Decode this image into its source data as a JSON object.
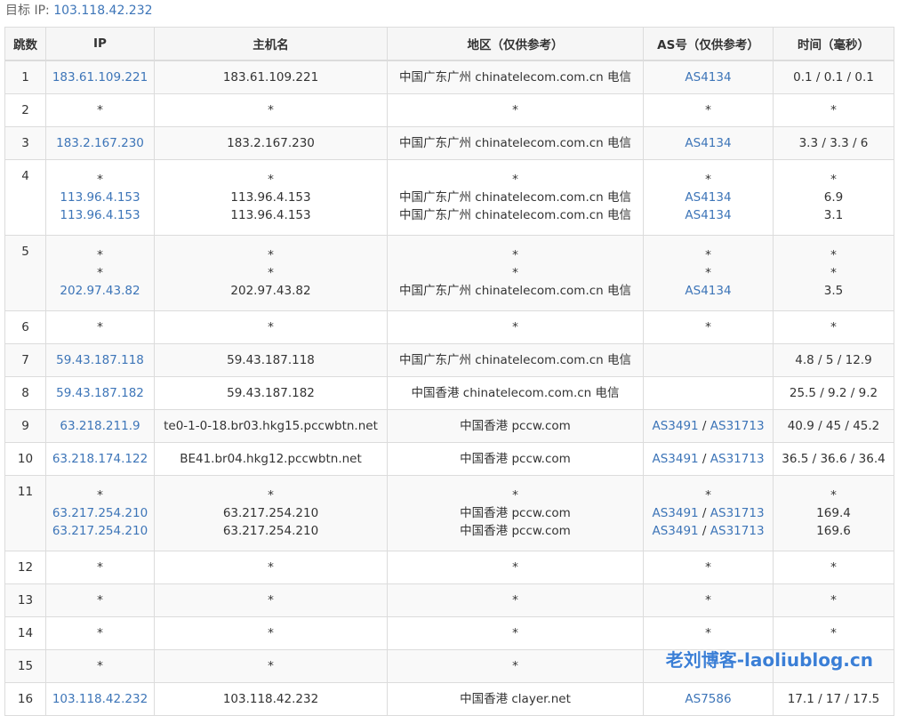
{
  "header": {
    "label": "目标 IP:",
    "ip": "103.118.42.232"
  },
  "columns": [
    "跳数",
    "IP",
    "主机名",
    "地区（仅供参考）",
    "AS号（仅供参考）",
    "时间（毫秒）"
  ],
  "rows": [
    {
      "hop": "1",
      "entries": [
        {
          "ip": "183.61.109.221",
          "host": "183.61.109.221",
          "region": "中国广东广州 chinatelecom.com.cn 电信",
          "as": [
            "AS4134"
          ],
          "time": "0.1 / 0.1 / 0.1"
        }
      ]
    },
    {
      "hop": "2",
      "entries": [
        {
          "ip": "*",
          "host": "*",
          "region": "*",
          "as": [
            "*"
          ],
          "time": "*"
        }
      ]
    },
    {
      "hop": "3",
      "entries": [
        {
          "ip": "183.2.167.230",
          "host": "183.2.167.230",
          "region": "中国广东广州 chinatelecom.com.cn 电信",
          "as": [
            "AS4134"
          ],
          "time": "3.3 / 3.3 / 6"
        }
      ]
    },
    {
      "hop": "4",
      "entries": [
        {
          "ip": "*",
          "host": "*",
          "region": "*",
          "as": [
            "*"
          ],
          "time": "*"
        },
        {
          "ip": "113.96.4.153",
          "host": "113.96.4.153",
          "region": "中国广东广州 chinatelecom.com.cn 电信",
          "as": [
            "AS4134"
          ],
          "time": "6.9"
        },
        {
          "ip": "113.96.4.153",
          "host": "113.96.4.153",
          "region": "中国广东广州 chinatelecom.com.cn 电信",
          "as": [
            "AS4134"
          ],
          "time": "3.1"
        }
      ]
    },
    {
      "hop": "5",
      "entries": [
        {
          "ip": "*",
          "host": "*",
          "region": "*",
          "as": [
            "*"
          ],
          "time": "*"
        },
        {
          "ip": "*",
          "host": "*",
          "region": "*",
          "as": [
            "*"
          ],
          "time": "*"
        },
        {
          "ip": "202.97.43.82",
          "host": "202.97.43.82",
          "region": "中国广东广州 chinatelecom.com.cn 电信",
          "as": [
            "AS4134"
          ],
          "time": "3.5"
        }
      ]
    },
    {
      "hop": "6",
      "entries": [
        {
          "ip": "*",
          "host": "*",
          "region": "*",
          "as": [
            "*"
          ],
          "time": "*"
        }
      ]
    },
    {
      "hop": "7",
      "entries": [
        {
          "ip": "59.43.187.118",
          "host": "59.43.187.118",
          "region": "中国广东广州 chinatelecom.com.cn 电信",
          "as": [],
          "time": "4.8 / 5 / 12.9"
        }
      ]
    },
    {
      "hop": "8",
      "entries": [
        {
          "ip": "59.43.187.182",
          "host": "59.43.187.182",
          "region": "中国香港 chinatelecom.com.cn 电信",
          "as": [],
          "time": "25.5 / 9.2 / 9.2"
        }
      ]
    },
    {
      "hop": "9",
      "entries": [
        {
          "ip": "63.218.211.9",
          "host": "te0-1-0-18.br03.hkg15.pccwbtn.net",
          "region": "中国香港 pccw.com",
          "as": [
            "AS3491",
            "AS31713"
          ],
          "time": "40.9 / 45 / 45.2"
        }
      ]
    },
    {
      "hop": "10",
      "entries": [
        {
          "ip": "63.218.174.122",
          "host": "BE41.br04.hkg12.pccwbtn.net",
          "region": "中国香港 pccw.com",
          "as": [
            "AS3491",
            "AS31713"
          ],
          "time": "36.5 / 36.6 / 36.4"
        }
      ]
    },
    {
      "hop": "11",
      "entries": [
        {
          "ip": "*",
          "host": "*",
          "region": "*",
          "as": [
            "*"
          ],
          "time": "*"
        },
        {
          "ip": "63.217.254.210",
          "host": "63.217.254.210",
          "region": "中国香港 pccw.com",
          "as": [
            "AS3491",
            "AS31713"
          ],
          "time": "169.4"
        },
        {
          "ip": "63.217.254.210",
          "host": "63.217.254.210",
          "region": "中国香港 pccw.com",
          "as": [
            "AS3491",
            "AS31713"
          ],
          "time": "169.6"
        }
      ]
    },
    {
      "hop": "12",
      "entries": [
        {
          "ip": "*",
          "host": "*",
          "region": "*",
          "as": [
            "*"
          ],
          "time": "*"
        }
      ]
    },
    {
      "hop": "13",
      "entries": [
        {
          "ip": "*",
          "host": "*",
          "region": "*",
          "as": [
            "*"
          ],
          "time": "*"
        }
      ]
    },
    {
      "hop": "14",
      "entries": [
        {
          "ip": "*",
          "host": "*",
          "region": "*",
          "as": [
            "*"
          ],
          "time": "*"
        }
      ]
    },
    {
      "hop": "15",
      "entries": [
        {
          "ip": "*",
          "host": "*",
          "region": "*",
          "as": [
            "*"
          ],
          "time": "*"
        }
      ]
    },
    {
      "hop": "16",
      "entries": [
        {
          "ip": "103.118.42.232",
          "host": "103.118.42.232",
          "region": "中国香港 clayer.net",
          "as": [
            "AS7586"
          ],
          "time": "17.1 / 17 / 17.5"
        }
      ]
    }
  ],
  "watermark": "老刘博客-laoliublog.cn",
  "colors": {
    "link": "#3d75b8",
    "border": "#dcdcdc",
    "stripe": "#f9f9f9",
    "watermark": "#3b7fd6"
  }
}
